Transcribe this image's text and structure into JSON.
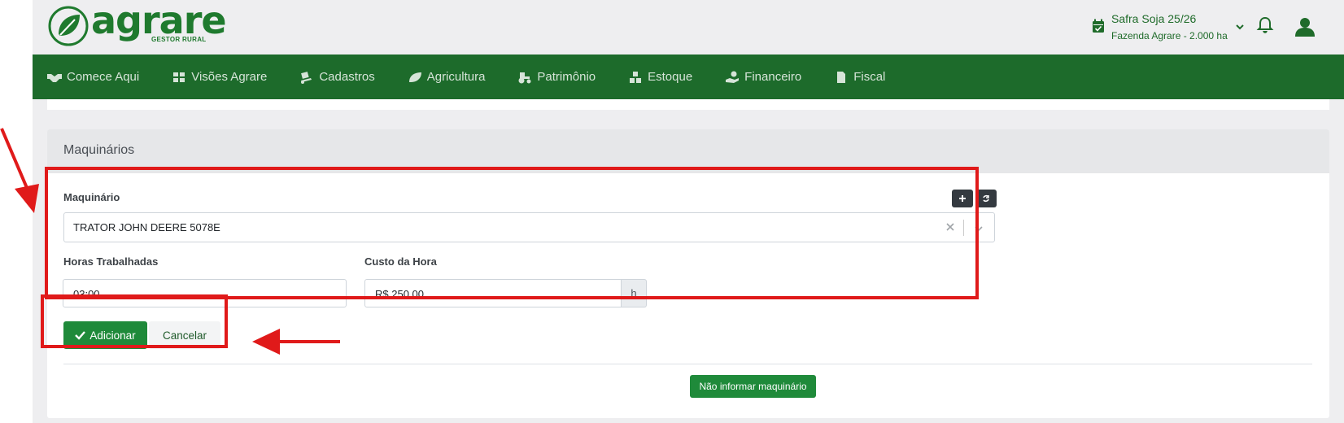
{
  "brand": {
    "name": "agrare",
    "tagline": "GESTOR RURAL",
    "color": "#1f7a2e"
  },
  "header": {
    "safra_title": "Safra Soja 25/26",
    "safra_subtitle": "Fazenda Agrare - 2.000 ha",
    "icons": [
      "calendar-check-icon",
      "chevron-down-icon",
      "bell-icon",
      "user-icon"
    ]
  },
  "nav": {
    "bg_color": "#1d6b2b",
    "items": [
      {
        "label": "Comece Aqui",
        "icon": "handshake-icon"
      },
      {
        "label": "Visões Agrare",
        "icon": "grid-icon"
      },
      {
        "label": "Cadastros",
        "icon": "dolly-icon"
      },
      {
        "label": "Agricultura",
        "icon": "leaf-icon"
      },
      {
        "label": "Patrimônio",
        "icon": "tractor-icon"
      },
      {
        "label": "Estoque",
        "icon": "boxes-icon"
      },
      {
        "label": "Financeiro",
        "icon": "hand-holding-dollar-icon"
      },
      {
        "label": "Fiscal",
        "icon": "file-invoice-icon"
      }
    ]
  },
  "card": {
    "title": "Maquinários",
    "maquinario_label": "Maquinário",
    "maquinario_value": "TRATOR JOHN DEERE 5078E",
    "horas_label": "Horas Trabalhadas",
    "horas_value": "03:00",
    "custo_label": "Custo da Hora",
    "custo_value": "R$ 250,00",
    "custo_addon": "h",
    "add_button": "Adicionar",
    "cancel_button": "Cancelar",
    "no_info_button": "Não informar maquinário"
  },
  "colors": {
    "primary_button": "#1f8a3a",
    "annotation": "#e01a1a",
    "dark_button": "#343a40"
  }
}
